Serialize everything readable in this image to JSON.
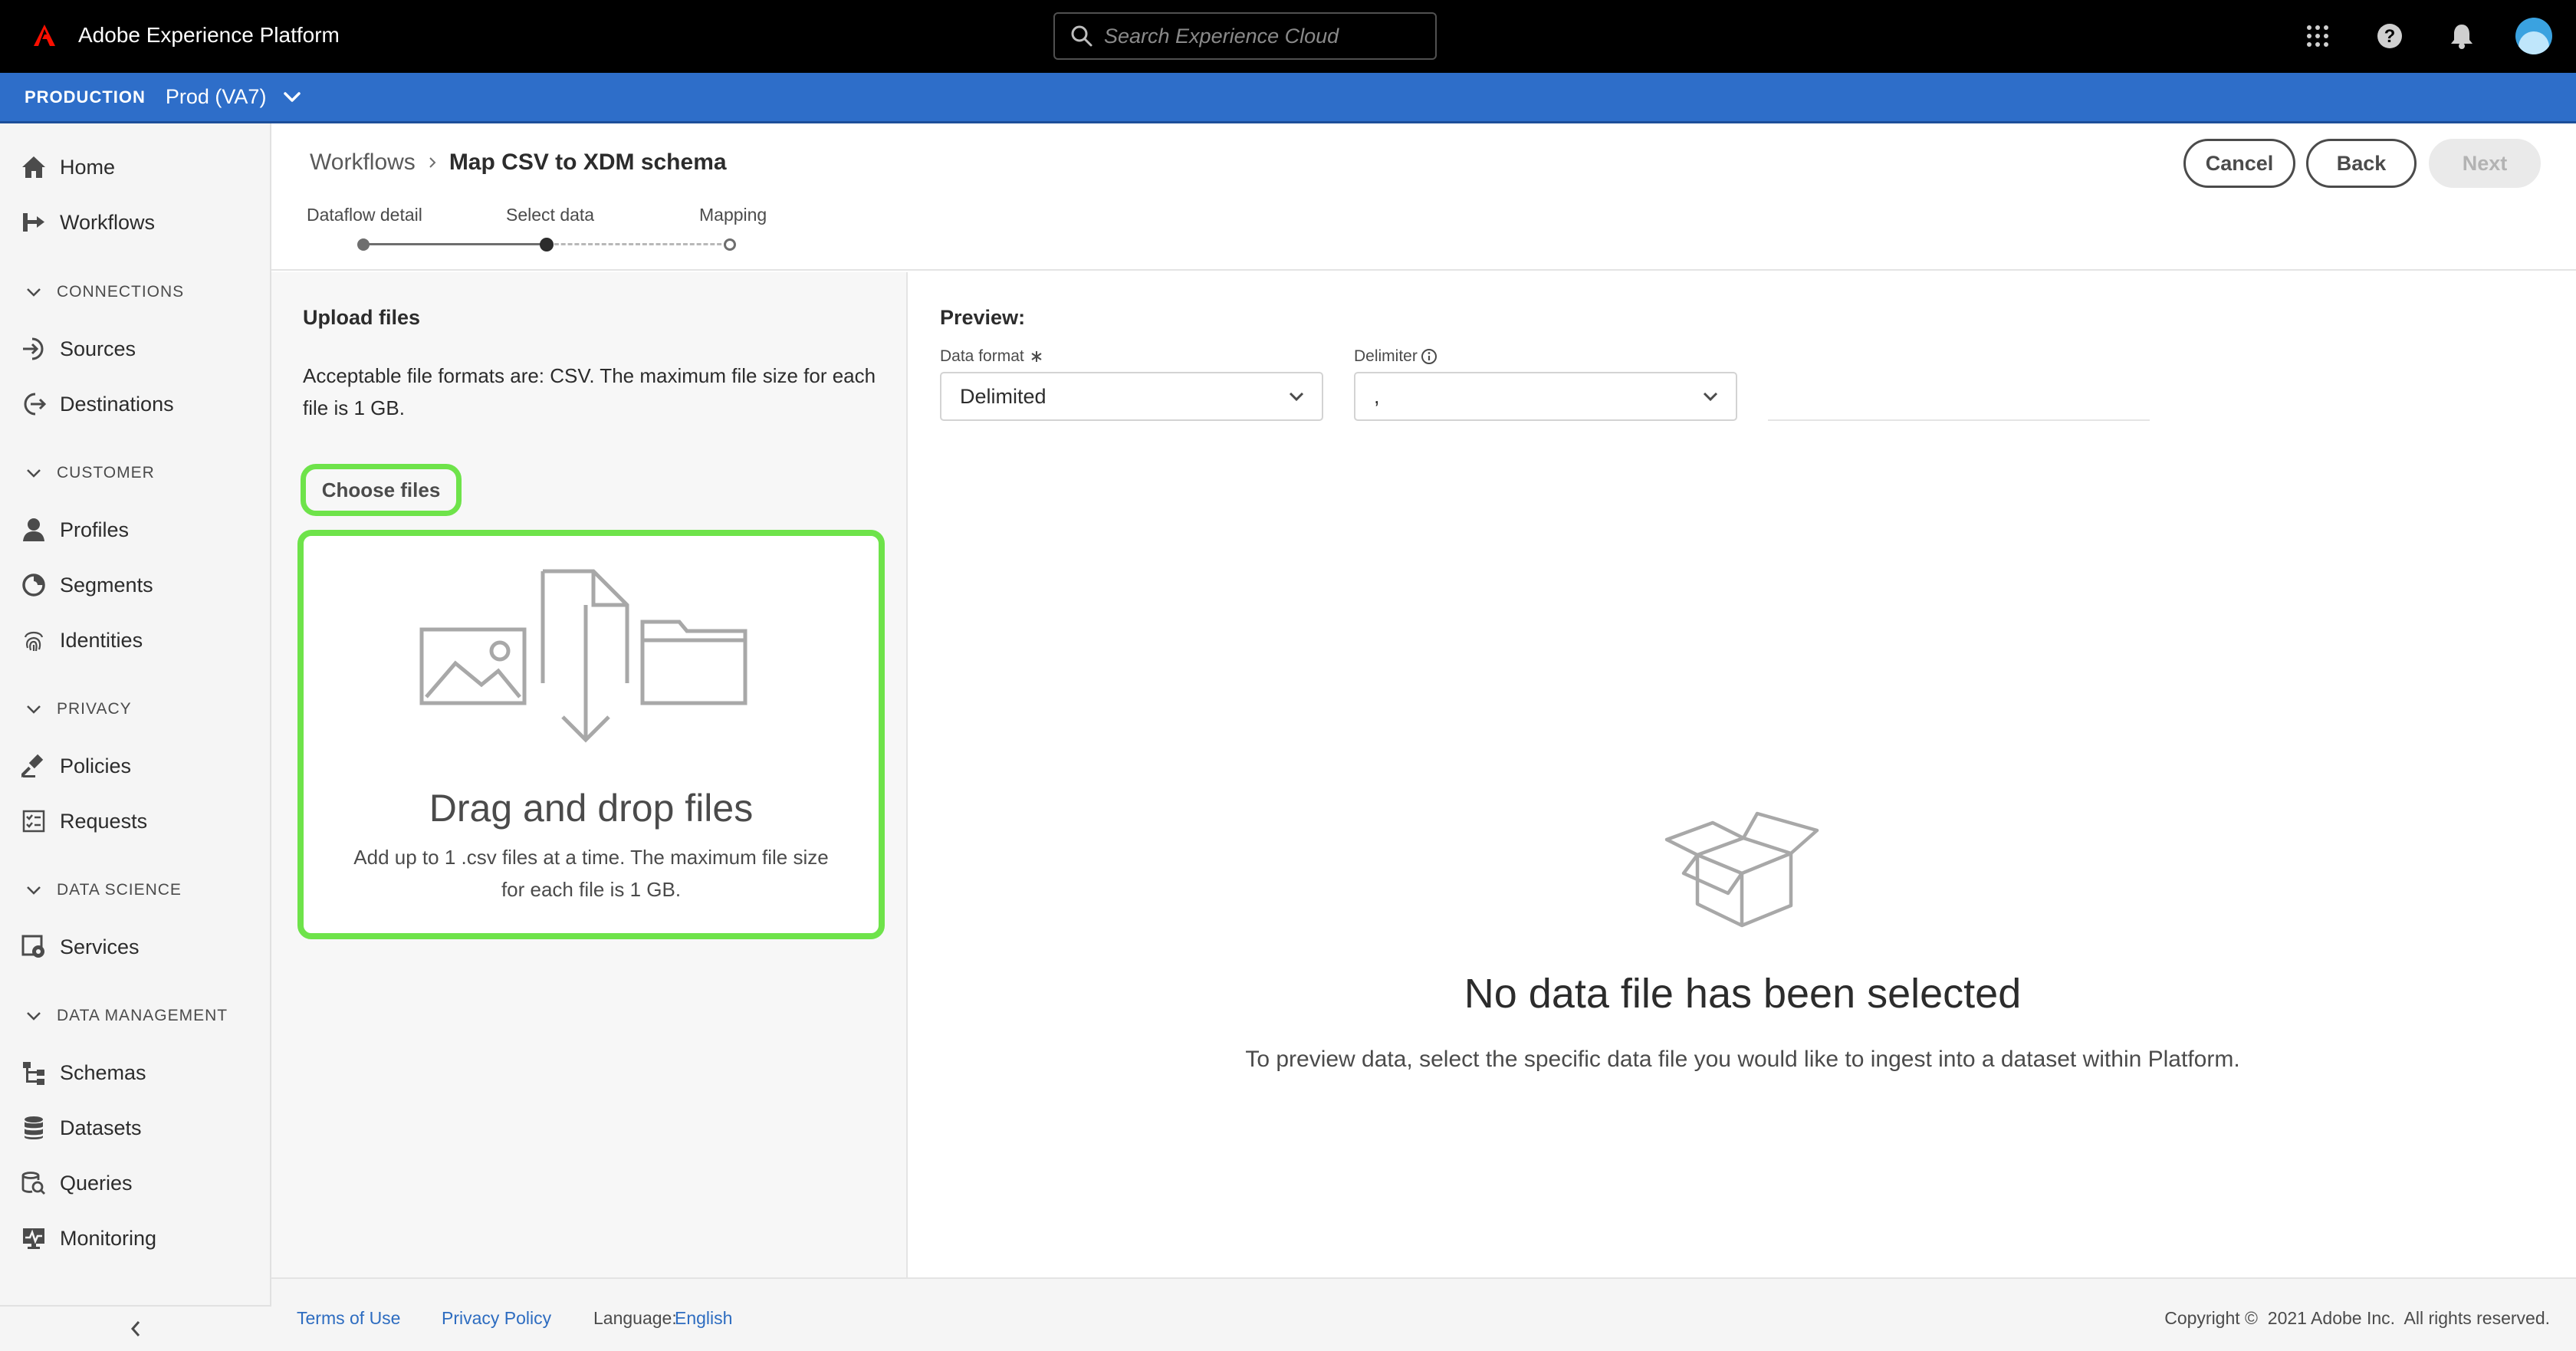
{
  "app": {
    "title": "Adobe Experience Platform"
  },
  "search": {
    "placeholder": "Search Experience Cloud"
  },
  "top_icons": [
    "apps-grid-icon",
    "help-icon",
    "bell-icon",
    "avatar"
  ],
  "environment": {
    "label": "PRODUCTION",
    "value": "Prod (VA7)"
  },
  "sidebar": {
    "home": "Home",
    "workflows": "Workflows",
    "connections": {
      "title": "CONNECTIONS",
      "items": [
        "Sources",
        "Destinations"
      ]
    },
    "customer": {
      "title": "CUSTOMER",
      "items": [
        "Profiles",
        "Segments",
        "Identities"
      ]
    },
    "privacy": {
      "title": "PRIVACY",
      "items": [
        "Policies",
        "Requests"
      ]
    },
    "data_science": {
      "title": "DATA SCIENCE",
      "items": [
        "Services"
      ]
    },
    "data_management": {
      "title": "DATA MANAGEMENT",
      "items": [
        "Schemas",
        "Datasets",
        "Queries",
        "Monitoring"
      ]
    }
  },
  "breadcrumb": {
    "parent": "Workflows",
    "current": "Map CSV to XDM schema"
  },
  "actions": {
    "cancel": "Cancel",
    "back": "Back",
    "next": "Next"
  },
  "steps": {
    "items": [
      "Dataflow detail",
      "Select data",
      "Mapping"
    ],
    "active_step": 2
  },
  "upload": {
    "title": "Upload files",
    "description": "Acceptable file formats are: CSV. The maximum file size for each file is 1 GB.",
    "choose_button": "Choose files",
    "drop_title": "Drag and drop files",
    "drop_subtitle": "Add up to 1 .csv files at a time. The maximum file size for each file is 1 GB."
  },
  "preview": {
    "title": "Preview:",
    "data_format_label": "Data format",
    "data_format_value": "Delimited",
    "delimiter_label": "Delimiter",
    "delimiter_value": ",",
    "empty_title": "No data file has been selected",
    "empty_description": "To preview data, select the specific data file you would like to ingest into a dataset within Platform."
  },
  "footer": {
    "terms": "Terms of Use",
    "privacy": "Privacy Policy",
    "language_label": "Language:",
    "language_value": "English",
    "copyright": "Copyright ©  2021 Adobe Inc.  All rights reserved."
  },
  "colors": {
    "accent_blue": "#2e6ec9",
    "highlight_green": "#6ee34a",
    "adobe_red": "#fa0f00"
  }
}
